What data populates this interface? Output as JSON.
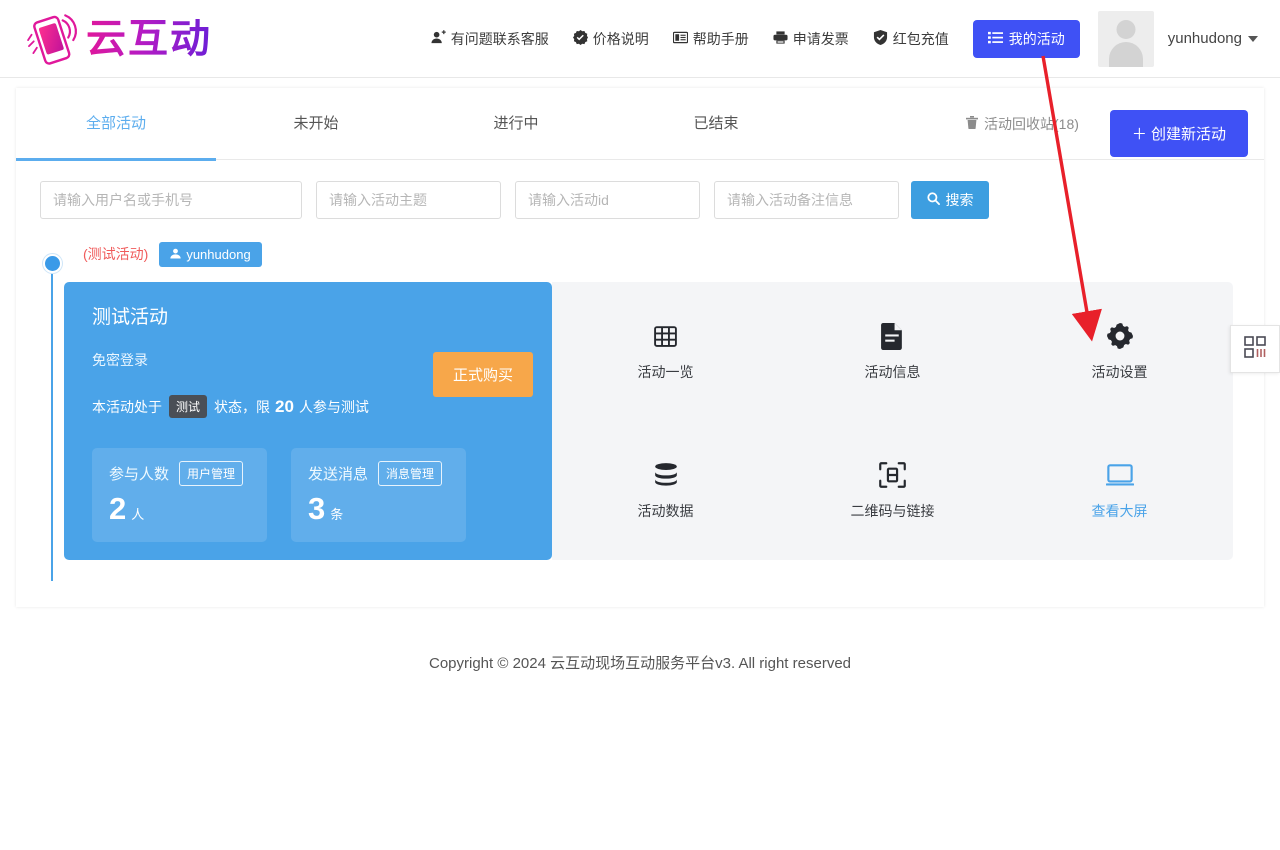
{
  "header": {
    "logo_text": "云互动",
    "logo_icon": "phone-wave-icon",
    "nav": [
      {
        "label": "有问题联系客服",
        "icon": "user-add-icon"
      },
      {
        "label": "价格说明",
        "icon": "badge-check-icon"
      },
      {
        "label": "帮助手册",
        "icon": "book-icon"
      },
      {
        "label": "申请发票",
        "icon": "printer-icon"
      },
      {
        "label": "红包充值",
        "icon": "shield-check-icon"
      }
    ],
    "my_activities_button": "我的活动",
    "my_activities_icon": "list-icon",
    "user_name": "yunhudong"
  },
  "tabs": [
    {
      "label": "全部活动",
      "active": true
    },
    {
      "label": "未开始",
      "active": false
    },
    {
      "label": "进行中",
      "active": false
    },
    {
      "label": "已结束",
      "active": false
    }
  ],
  "recycle_bin": {
    "label": "活动回收站(18)",
    "icon": "trash-icon"
  },
  "create_button": "＋ 创建新活动",
  "search": {
    "username_placeholder": "请输入用户名或手机号",
    "theme_placeholder": "请输入活动主题",
    "id_placeholder": "请输入活动id",
    "remark_placeholder": "请输入活动备注信息",
    "username_value": "",
    "theme_value": "",
    "id_value": "",
    "remark_value": "",
    "button_label": "搜索",
    "button_icon": "search-icon"
  },
  "activity": {
    "test_tag": "(测试活动)",
    "owner_badge": "yunhudong",
    "owner_icon": "user-icon",
    "title": "测试活动",
    "subtitle": "免密登录",
    "status_prefix": "本活动处于",
    "status_pill": "测试",
    "status_middle": "状态，限",
    "status_limit": "20",
    "status_suffix": "人参与测试",
    "buy_button": "正式购买",
    "stats": [
      {
        "label": "参与人数",
        "action": "用户管理",
        "value": "2",
        "unit": "人"
      },
      {
        "label": "发送消息",
        "action": "消息管理",
        "value": "3",
        "unit": "条"
      }
    ],
    "tiles": [
      {
        "label": "活动一览",
        "icon": "grid-icon",
        "highlight": false
      },
      {
        "label": "活动信息",
        "icon": "document-icon",
        "highlight": false
      },
      {
        "label": "活动设置",
        "icon": "gear-icon",
        "highlight": false
      },
      {
        "label": "活动数据",
        "icon": "database-icon",
        "highlight": false
      },
      {
        "label": "二维码与链接",
        "icon": "qr-scan-icon",
        "highlight": false
      },
      {
        "label": "查看大屏",
        "icon": "monitor-icon",
        "highlight": true
      }
    ]
  },
  "qr_float_icon": "qr-code-icon",
  "footer": "Copyright © 2024 云互动现场互动服务平台v3. All right reserved",
  "annotation": {
    "type": "arrow",
    "color": "#e8202a",
    "points_to": "活动设置"
  },
  "colors": {
    "primary_blue": "#3f51f5",
    "accent_blue": "#4aa3e8",
    "search_blue": "#3d9ee0",
    "orange": "#f7a74a",
    "red_tag": "#f05b5b",
    "panel_grey": "#f4f5f7"
  }
}
